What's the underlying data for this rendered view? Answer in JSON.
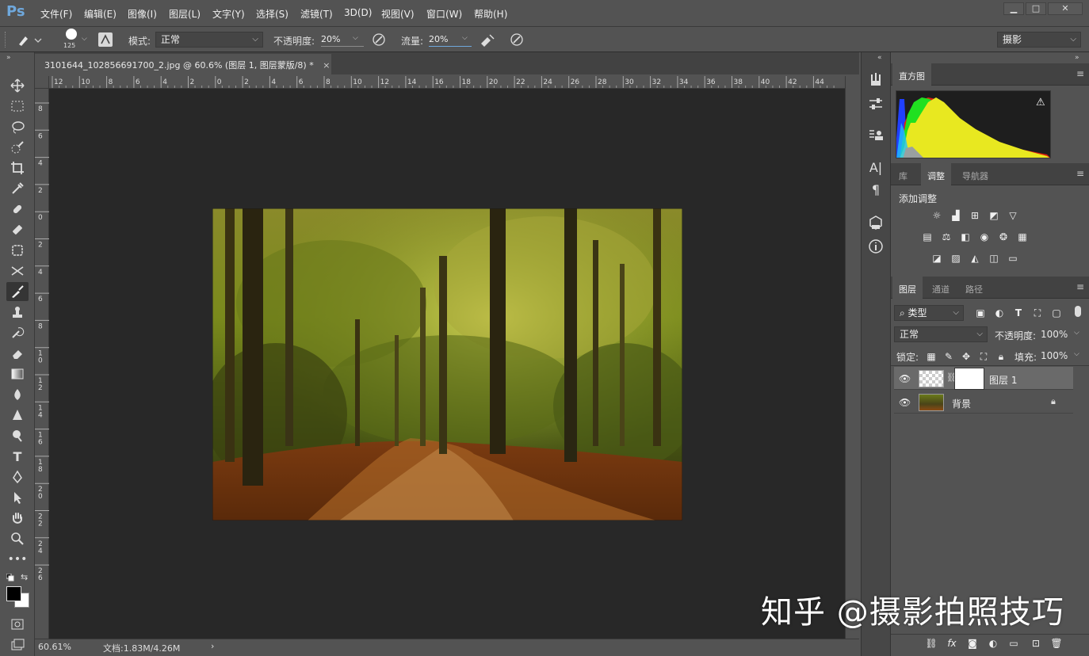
{
  "app": {
    "logo": "Ps"
  },
  "menu": [
    "文件(F)",
    "编辑(E)",
    "图像(I)",
    "图层(L)",
    "文字(Y)",
    "选择(S)",
    "滤镜(T)",
    "3D(D)",
    "视图(V)",
    "窗口(W)",
    "帮助(H)"
  ],
  "window_controls": {
    "minimize": "▁",
    "maximize": "□",
    "close": "✕"
  },
  "options": {
    "brush_size": "125",
    "mode_label": "模式:",
    "mode_value": "正常",
    "opacity_label": "不透明度:",
    "opacity_value": "20%",
    "flow_label": "流量:",
    "flow_value": "20%",
    "workspace": "摄影"
  },
  "document": {
    "tab_title": "3101644_102856691700_2.jpg @ 60.6% (图层 1, 图层蒙版/8) *",
    "close": "×"
  },
  "ruler": {
    "h_ticks": [
      "12",
      "10",
      "8",
      "6",
      "4",
      "2",
      "0",
      "2",
      "4",
      "6",
      "8",
      "10",
      "12",
      "14",
      "16",
      "18",
      "20",
      "22",
      "24",
      "26",
      "28",
      "30",
      "32",
      "34",
      "36",
      "38",
      "40",
      "42",
      "44"
    ],
    "v_ticks": [
      "8",
      "6",
      "4",
      "2",
      "0",
      "2",
      "4",
      "6",
      "8",
      "1\n0",
      "1\n2",
      "1\n4",
      "1\n6",
      "1\n8",
      "2\n0",
      "2\n2",
      "2\n4",
      "2\n6"
    ]
  },
  "status": {
    "zoom": "60.61%",
    "doc_label": "文档:1.83M/4.26M",
    "arrow": "›"
  },
  "panels": {
    "histogram_tab": "直方图",
    "adjust_tabs": [
      "库",
      "调整",
      "导航器"
    ],
    "adjust_title": "添加调整",
    "layers_tabs": [
      "图层",
      "通道",
      "路径"
    ],
    "filter_kind": "类型",
    "blend_mode": "正常",
    "opacity_label": "不透明度:",
    "opacity_value": "100%",
    "lock_label": "锁定:",
    "fill_label": "填充:",
    "fill_value": "100%",
    "layers": [
      {
        "name": "图层 1"
      },
      {
        "name": "背景"
      }
    ],
    "footer_fx": "fx"
  },
  "watermark": "知乎 @摄影拍照技巧",
  "colors": {
    "accent": "#6fa8dc",
    "panel": "#535353",
    "canvas": "#282828"
  }
}
